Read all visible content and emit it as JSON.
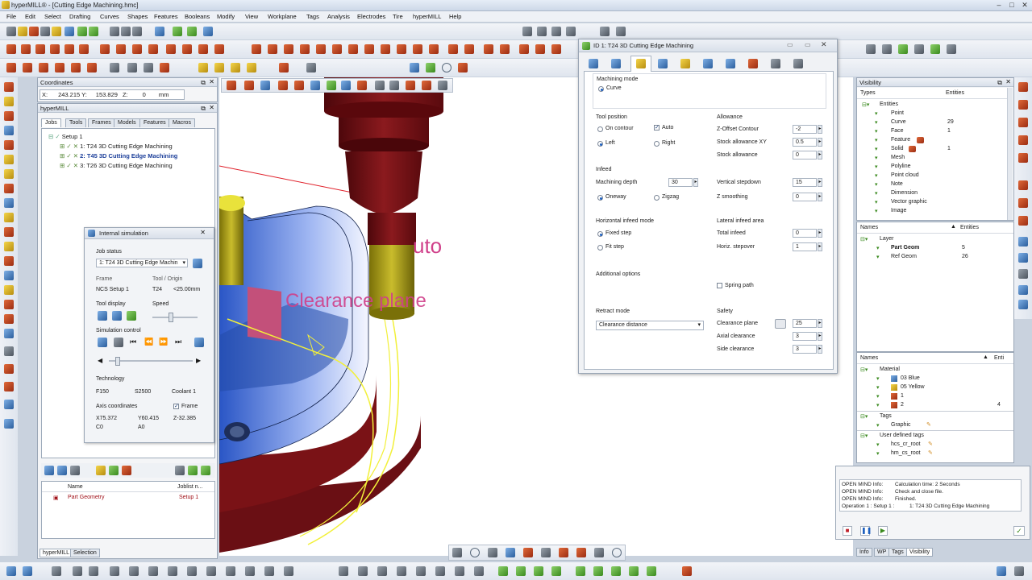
{
  "window": {
    "title": "hyperMILL® - [Cutting Edge Machining.hmc]"
  },
  "menu": [
    "File",
    "Edit",
    "Select",
    "Drafting",
    "Curves",
    "Shapes",
    "Features",
    "Booleans",
    "Modify",
    "View",
    "Workplane",
    "Tags",
    "Analysis",
    "Electrodes",
    "Tire",
    "hyperMILL",
    "Help"
  ],
  "coordinates": {
    "title": "Coordinates",
    "x_label": "X:",
    "x": "243.215",
    "y_label": "Y:",
    "y": "153.829",
    "z_label": "Z:",
    "z": "0",
    "unit": "mm"
  },
  "hypermill": {
    "title": "hyperMILL",
    "tabs": [
      "Jobs",
      "Tools",
      "Frames",
      "Models",
      "Features",
      "Macros"
    ],
    "setup": "Setup 1",
    "jobs": [
      "1: T24 3D Cutting Edge Machining",
      "2: T45 3D Cutting Edge Machining",
      "3: T26 3D Cutting Edge Machining"
    ],
    "list_headers": [
      "Name",
      "Joblist n..."
    ],
    "list_row": {
      "name": "Part Geometry",
      "joblist": "Setup 1"
    },
    "bottom_tabs": [
      "hyperMILL",
      "Selection"
    ]
  },
  "simulation": {
    "title": "Internal simulation",
    "job_status_label": "Job status",
    "job_value": "1: T24 3D Cutting Edge Machin",
    "frame_label": "Frame",
    "frame_value": "NCS Setup 1",
    "tool_label": "Tool / Origin",
    "tool_value": "T24",
    "origin_value": "<25.00mm",
    "tool_display_label": "Tool display",
    "speed_label": "Speed",
    "sim_control_label": "Simulation control",
    "technology_label": "Technology",
    "feed": "F150",
    "spindle": "S2500",
    "coolant": "Coolant 1",
    "axis_label": "Axis coordinates",
    "frame_chk": "Frame",
    "ax": {
      "x": "X75.372",
      "y": "Y60.415",
      "z": "Z-32.385",
      "c": "C0",
      "a": "A0"
    }
  },
  "viewport": {
    "clearance_text": "Clearance plane",
    "auto_text": "uto"
  },
  "dialog": {
    "title": "ID 1: T24 3D Cutting Edge Machining",
    "machining_mode_label": "Machining mode",
    "curve_label": "Curve",
    "tool_position_label": "Tool position",
    "on_contour": "On contour",
    "auto": "Auto",
    "left": "Left",
    "right": "Right",
    "allowance_label": "Allowance",
    "z_offset_label": "Z-Offset Contour",
    "z_offset": "-2",
    "stock_xy_label": "Stock allowance XY",
    "stock_xy": "0.5",
    "stock_label": "Stock allowance",
    "stock": "0",
    "infeed_label": "Infeed",
    "mdepth_label": "Machining depth",
    "mdepth": "30",
    "vstep_label": "Vertical stepdown",
    "vstep": "15",
    "oneway": "Oneway",
    "zigzag": "Zigzag",
    "zsmooth_label": "Z smoothing",
    "zsmooth": "0",
    "h_infeed_label": "Horizontal infeed mode",
    "fixed_step": "Fixed step",
    "fit_step": "Fit step",
    "lat_infeed_label": "Lateral infeed area",
    "total_infeed_label": "Total infeed",
    "total_infeed": "0",
    "hstep_label": "Horiz. stepover",
    "hstep": "1",
    "additional_label": "Additional options",
    "spring_path": "Spring path",
    "retract_label": "Retract mode",
    "retract_value": "Clearance distance",
    "safety_label": "Safety",
    "clear_plane_label": "Clearance plane",
    "clear_plane": "25",
    "axial_label": "Axial clearance",
    "axial": "3",
    "side_label": "Side clearance",
    "side": "3"
  },
  "visibility": {
    "title": "Visibility",
    "types_header": "Types",
    "entities_header": "Entities",
    "types": [
      {
        "name": "Entities",
        "count": ""
      },
      {
        "name": "Point",
        "count": ""
      },
      {
        "name": "Curve",
        "count": "29"
      },
      {
        "name": "Face",
        "count": "1"
      },
      {
        "name": "Feature",
        "count": ""
      },
      {
        "name": "Solid",
        "count": "1"
      },
      {
        "name": "Mesh",
        "count": ""
      },
      {
        "name": "Polyline",
        "count": ""
      },
      {
        "name": "Point cloud",
        "count": ""
      },
      {
        "name": "Note",
        "count": ""
      },
      {
        "name": "Dimension",
        "count": ""
      },
      {
        "name": "Vector graphic",
        "count": ""
      },
      {
        "name": "Image",
        "count": ""
      }
    ],
    "names_header": "Names",
    "names_entities": "Entities",
    "layer": "Layer",
    "layers": [
      {
        "name": "Part Geom",
        "count": "5"
      },
      {
        "name": "Ref Geom",
        "count": "26"
      }
    ],
    "names2_header": "Names",
    "names2_ent": "Enti",
    "material": "Material",
    "materials": [
      {
        "name": "03 Blue",
        "count": ""
      },
      {
        "name": "05 Yellow",
        "count": ""
      },
      {
        "name": "1",
        "count": ""
      },
      {
        "name": "2",
        "count": "4"
      }
    ],
    "tags": "Tags",
    "graphic": "Graphic",
    "user_tags": "User defined tags",
    "user_tag_items": [
      "hcs_cr_root",
      "hm_cs_root"
    ]
  },
  "log": {
    "lines": [
      [
        "OPEN MIND Info:",
        "Calculation time: 2 Seconds"
      ],
      [
        "OPEN MIND Info:",
        "Check and close file."
      ],
      [
        "OPEN MIND Info:",
        "Finished."
      ],
      [
        "Operation 1 : Setup 1 :",
        "1: T24 3D Cutting Edge Machining"
      ]
    ]
  },
  "right_tabs": [
    "Info",
    "WP",
    "Tags",
    "Visibility"
  ],
  "colors": {
    "clearance": "#d0408a",
    "tool_head": "#7a0d12",
    "holder": "#b3a51a",
    "part": "#2f5fcf",
    "flange": "#7a0d12"
  }
}
